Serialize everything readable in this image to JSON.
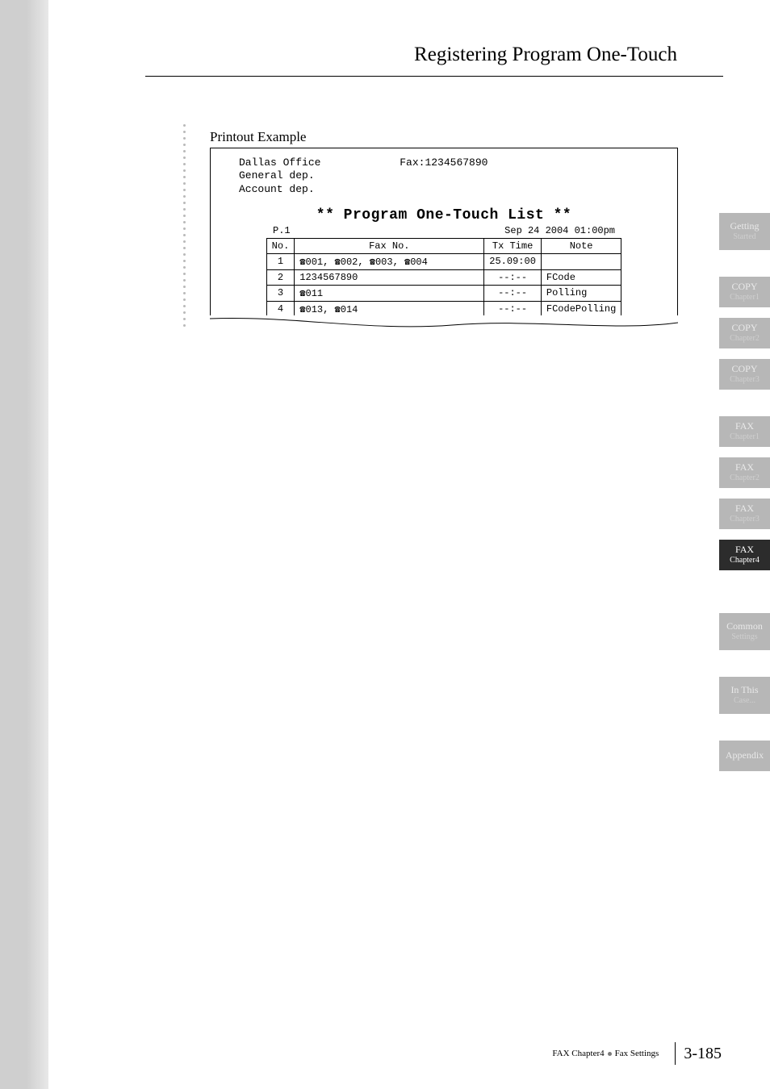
{
  "header": {
    "title": "Registering Program One-Touch"
  },
  "section": {
    "label": "Printout Example"
  },
  "printout": {
    "org_line1": "Dallas Office",
    "org_line2": "General dep.",
    "org_line3": "Account dep.",
    "fax_label": "Fax:1234567890",
    "title": "** Program One-Touch List **",
    "page_label": "P.1",
    "datetime": "Sep 24 2004 01:00pm",
    "headers": {
      "no": "No.",
      "fax": "Fax No.",
      "tx": "Tx Time",
      "note": "Note"
    },
    "rows": [
      {
        "no": "1",
        "fax": "☎001, ☎002, ☎003, ☎004",
        "tx": "25.09:00",
        "note": ""
      },
      {
        "no": "2",
        "fax": "1234567890",
        "tx": "--:--",
        "note": "FCode"
      },
      {
        "no": "3",
        "fax": "☎011",
        "tx": "--:--",
        "note": "Polling"
      },
      {
        "no": "4",
        "fax": "☎013, ☎014",
        "tx": "--:--",
        "note": "FCodePolling"
      }
    ]
  },
  "tabs": [
    {
      "l1": "Getting",
      "l2": "Started",
      "active": false
    },
    {
      "l1": "COPY",
      "l2": "Chapter1",
      "active": false
    },
    {
      "l1": "COPY",
      "l2": "Chapter2",
      "active": false
    },
    {
      "l1": "COPY",
      "l2": "Chapter3",
      "active": false
    },
    {
      "l1": "FAX",
      "l2": "Chapter1",
      "active": false
    },
    {
      "l1": "FAX",
      "l2": "Chapter2",
      "active": false
    },
    {
      "l1": "FAX",
      "l2": "Chapter3",
      "active": false
    },
    {
      "l1": "FAX",
      "l2": "Chapter4",
      "active": true
    },
    {
      "l1": "Common",
      "l2": "Settings",
      "active": false
    },
    {
      "l1": "In This",
      "l2": "Case...",
      "active": false
    },
    {
      "l1": "Appendix",
      "l2": "",
      "active": false
    }
  ],
  "footer": {
    "crumb1": "FAX Chapter4",
    "crumb2": "Fax Settings",
    "page": "3-185"
  }
}
